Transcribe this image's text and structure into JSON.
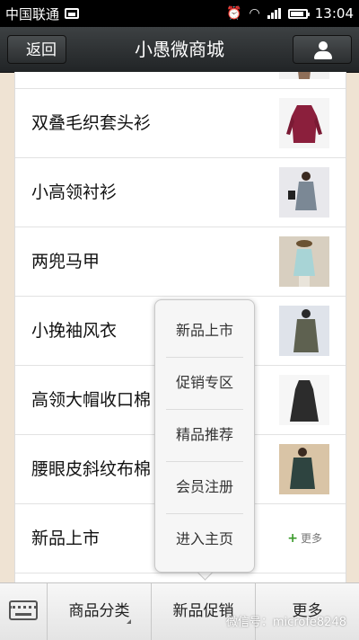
{
  "status_bar": {
    "carrier": "中国联通",
    "time": "13:04",
    "icons": [
      "image-icon",
      "alarm-icon",
      "wifi-icon",
      "signal-icon",
      "battery-icon"
    ]
  },
  "header": {
    "back_label": "返回",
    "title": "小愚微商城",
    "profile_icon": "person-icon"
  },
  "list": {
    "items": [
      {
        "label": "",
        "thumb": "clothing-photo",
        "colors": [
          "#8e6e58",
          "#f2f2f2"
        ]
      },
      {
        "label": "双叠毛织套头衫",
        "thumb": "clothing-photo",
        "colors": [
          "#8b1f3c",
          "#f5f5f5"
        ]
      },
      {
        "label": "小高领衬衫",
        "thumb": "clothing-photo",
        "colors": [
          "#7b8895",
          "#e8e8ec"
        ]
      },
      {
        "label": "两兜马甲",
        "thumb": "clothing-photo",
        "colors": [
          "#a8d4d6",
          "#d8cfc0"
        ]
      },
      {
        "label": "小挽袖风衣",
        "thumb": "clothing-photo",
        "colors": [
          "#5e6150",
          "#dfe3ea"
        ]
      },
      {
        "label": "高领大帽收口棉",
        "thumb": "clothing-photo",
        "colors": [
          "#2c2c2c",
          "#f6f6f6"
        ]
      },
      {
        "label": "腰眼皮斜纹布棉",
        "thumb": "clothing-photo",
        "colors": [
          "#2e4440",
          "#d9c4a6"
        ]
      },
      {
        "label": "新品上市",
        "more_label": "更多",
        "more_icon": "plus-icon"
      }
    ]
  },
  "popup_menu": {
    "items": [
      "新品上市",
      "促销专区",
      "精品推荐",
      "会员注册",
      "进入主页"
    ]
  },
  "bottom_bar": {
    "keyboard_icon": "keyboard-icon",
    "tabs": [
      "商品分类",
      "新品促销",
      "更多"
    ]
  },
  "watermark": "微信号：microfe8248"
}
